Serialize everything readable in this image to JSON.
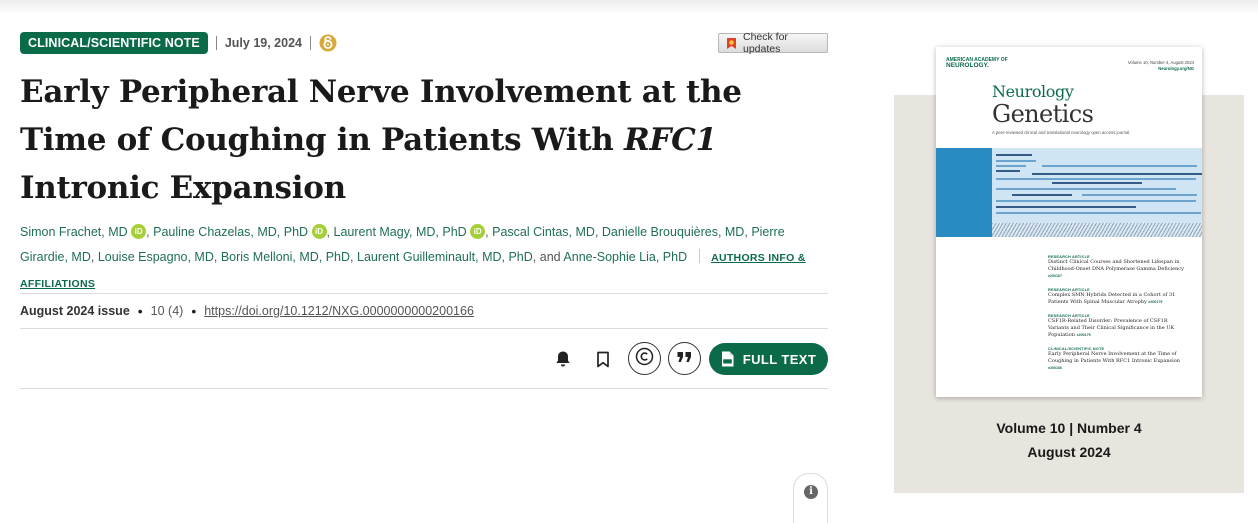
{
  "article": {
    "badge": "CLINICAL/SCIENTIFIC NOTE",
    "date": "July 19, 2024",
    "check_updates": "Check for updates",
    "title_part1": "Early Peripheral Nerve Involvement at the Time of Coughing in Patients With ",
    "title_italic": "RFC1",
    "title_part2": " Intronic Expansion",
    "authors": [
      {
        "name": "Simon Frachet, MD",
        "orcid": true
      },
      {
        "name": "Pauline Chazelas, MD, PhD",
        "orcid": true
      },
      {
        "name": "Laurent Magy, MD, PhD",
        "orcid": true
      },
      {
        "name": "Pascal Cintas, MD",
        "orcid": false
      },
      {
        "name": "Danielle Brouquières, MD",
        "orcid": false
      },
      {
        "name": "Pierre Girardie, MD",
        "orcid": false
      },
      {
        "name": "Louise Espagno, MD",
        "orcid": false
      },
      {
        "name": "Boris Melloni, MD, PhD",
        "orcid": false
      },
      {
        "name": "Laurent Guilleminault, MD, PhD",
        "orcid": false
      },
      {
        "name": "Anne-Sophie Lia, PhD",
        "orcid": false
      }
    ],
    "authors_sep": ",",
    "authors_and": "and",
    "authors_info_link": "AUTHORS INFO & AFFILIATIONS",
    "issue": "August 2024 issue",
    "volume": "10 (4)",
    "doi": "https://doi.org/10.1212/NXG.0000000000200166",
    "full_text": "FULL TEXT",
    "orcid_label": "iD"
  },
  "icons": {
    "open_access": "open-access-icon",
    "alert": "bell-icon",
    "bookmark": "bookmark-icon",
    "permissions": "copyright-icon",
    "cite": "quote-icon",
    "pdf": "pdf-icon",
    "info": "info-icon"
  },
  "cover": {
    "society_line1": "AMERICAN ACADEMY OF",
    "society_line2": "NEUROLOGY.",
    "issue_line": "Volume 10, Number 4, August 2024",
    "url": "Neurology.org/NG",
    "journal_line1": "Neurology",
    "journal_line2": "Genetics",
    "subtitle": "A peer-reviewed clinical and translational neurology open access journal",
    "articles": [
      {
        "label": "RESEARCH ARTICLE",
        "title": "Distinct Clinical Courses and Shortened Lifespan in Childhood-Onset DNA Polymerase Gamma Deficiency",
        "page": "e200167"
      },
      {
        "label": "RESEARCH ARTICLE",
        "title": "Complex SMN Hybrids Detected in a Cohort of 31 Patients With Spinal Muscular Atrophy",
        "page": "e200175"
      },
      {
        "label": "RESEARCH ARTICLE",
        "title": "CSF1R-Related Disorder: Prevalence of CSF1R Variants and Their Clinical Significance in the UK Population",
        "page": "e200179"
      },
      {
        "label": "CLINICAL/SCIENTIFIC NOTE",
        "title": "Early Peripheral Nerve Involvement at the Time of Coughing in Patients With RFC1 Intronic Expansion",
        "page": "e200166"
      }
    ]
  },
  "side": {
    "volume_line": "Volume 10 | Number 4",
    "month_line": "August 2024"
  },
  "colors": {
    "brand_green": "#0b6b48",
    "panel_bg": "#e8e4de",
    "orcid_green": "#a6ce39"
  }
}
